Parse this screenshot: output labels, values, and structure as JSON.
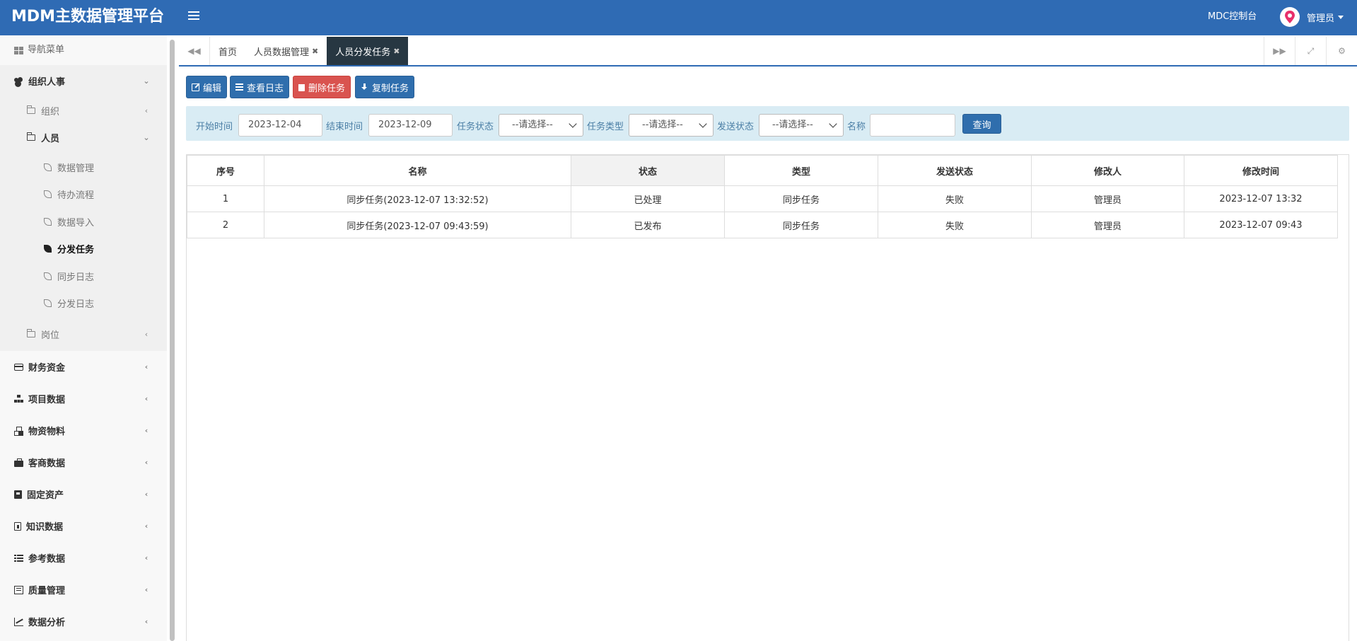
{
  "header": {
    "brand": "MDM主数据管理平台",
    "console_link": "MDC控制台",
    "user_name": "管理员",
    "accent": "#2f6bb4"
  },
  "sidebar": {
    "title": "导航菜单",
    "groups": [
      {
        "label": "组织人事",
        "icon": "users-icon",
        "children": [
          {
            "label": "组织",
            "icon": "folder-icon"
          },
          {
            "label": "人员",
            "icon": "folder-open-icon",
            "children": [
              {
                "label": "数据管理",
                "icon": "leaf-icon"
              },
              {
                "label": "待办流程",
                "icon": "leaf-icon"
              },
              {
                "label": "数据导入",
                "icon": "leaf-icon"
              },
              {
                "label": "分发任务",
                "icon": "leaf-icon",
                "active": true
              },
              {
                "label": "同步日志",
                "icon": "leaf-icon"
              },
              {
                "label": "分发日志",
                "icon": "leaf-icon"
              }
            ]
          },
          {
            "label": "岗位",
            "icon": "folder-icon"
          }
        ]
      },
      {
        "label": "财务资金",
        "icon": "credit-card-icon"
      },
      {
        "label": "项目数据",
        "icon": "sitemap-icon"
      },
      {
        "label": "物资物料",
        "icon": "cubes-icon"
      },
      {
        "label": "客商数据",
        "icon": "briefcase-icon"
      },
      {
        "label": "固定资产",
        "icon": "building-icon"
      },
      {
        "label": "知识数据",
        "icon": "file-icon"
      },
      {
        "label": "参考数据",
        "icon": "list-icon"
      },
      {
        "label": "质量管理",
        "icon": "list-alt-icon"
      },
      {
        "label": "数据分析",
        "icon": "line-chart-icon"
      }
    ]
  },
  "tabs": [
    {
      "label": "首页",
      "closable": false,
      "active": false
    },
    {
      "label": "人员数据管理",
      "closable": true,
      "active": false
    },
    {
      "label": "人员分发任务",
      "closable": true,
      "active": true
    }
  ],
  "toolbar": {
    "edit": "编辑",
    "view_log": "查看日志",
    "delete_task": "删除任务",
    "copy_task": "复制任务"
  },
  "search": {
    "start_label": "开始时间",
    "start_value": "2023-12-04",
    "end_label": "结束时间",
    "end_value": "2023-12-09",
    "task_status_label": "任务状态",
    "task_status_value": "--请选择--",
    "task_type_label": "任务类型",
    "task_type_value": "--请选择--",
    "send_status_label": "发送状态",
    "send_status_value": "--请选择--",
    "name_label": "名称",
    "name_value": "",
    "query_button": "查询"
  },
  "table": {
    "columns": [
      "序号",
      "名称",
      "状态",
      "类型",
      "发送状态",
      "修改人",
      "修改时间"
    ],
    "rows": [
      [
        "1",
        "同步任务(2023-12-07 13:32:52)",
        "已处理",
        "同步任务",
        "失败",
        "管理员",
        "2023-12-07 13:32"
      ],
      [
        "2",
        "同步任务(2023-12-07 09:43:59)",
        "已发布",
        "同步任务",
        "失败",
        "管理员",
        "2023-12-07 09:43"
      ]
    ]
  }
}
